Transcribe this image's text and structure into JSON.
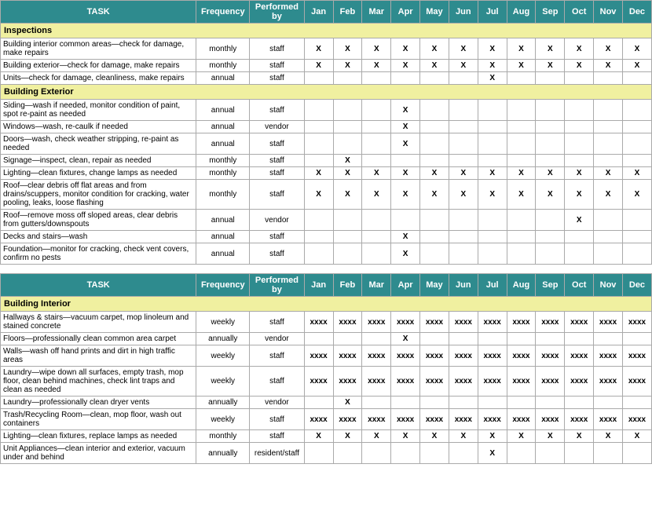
{
  "table1": {
    "header": {
      "task": "TASK",
      "frequency": "Frequency",
      "performed_by": "Performed by",
      "months": [
        "Jan",
        "Feb",
        "Mar",
        "Apr",
        "May",
        "Jun",
        "Jul",
        "Aug",
        "Sep",
        "Oct",
        "Nov",
        "Dec"
      ]
    },
    "sections": [
      {
        "title": "Inspections",
        "rows": [
          {
            "task": "Building interior common areas—check for damage, make repairs",
            "frequency": "monthly",
            "performed_by": "staff",
            "months": [
              "X",
              "X",
              "X",
              "X",
              "X",
              "X",
              "X",
              "X",
              "X",
              "X",
              "X",
              "X"
            ]
          },
          {
            "task": "Building exterior—check for damage, make repairs",
            "frequency": "monthly",
            "performed_by": "staff",
            "months": [
              "X",
              "X",
              "X",
              "X",
              "X",
              "X",
              "X",
              "X",
              "X",
              "X",
              "X",
              "X"
            ]
          },
          {
            "task": "Units—check for damage, cleanliness, make repairs",
            "frequency": "annual",
            "performed_by": "staff",
            "months": [
              "",
              "",
              "",
              "",
              "",
              "",
              "X",
              "",
              "",
              "",
              "",
              ""
            ]
          }
        ]
      },
      {
        "title": "Building Exterior",
        "rows": [
          {
            "task": "Siding—wash if needed, monitor condition of paint, spot re-paint as needed",
            "frequency": "annual",
            "performed_by": "staff",
            "months": [
              "",
              "",
              "",
              "X",
              "",
              "",
              "",
              "",
              "",
              "",
              "",
              ""
            ]
          },
          {
            "task": "Windows—wash, re-caulk if needed",
            "frequency": "annual",
            "performed_by": "vendor",
            "months": [
              "",
              "",
              "",
              "X",
              "",
              "",
              "",
              "",
              "",
              "",
              "",
              ""
            ]
          },
          {
            "task": "Doors—wash, check weather stripping, re-paint as needed",
            "frequency": "annual",
            "performed_by": "staff",
            "months": [
              "",
              "",
              "",
              "X",
              "",
              "",
              "",
              "",
              "",
              "",
              "",
              ""
            ]
          },
          {
            "task": "Signage—inspect, clean, repair as needed",
            "frequency": "monthly",
            "performed_by": "staff",
            "months": [
              "",
              "X",
              "",
              "",
              "",
              "",
              "",
              "",
              "",
              "",
              "",
              ""
            ]
          },
          {
            "task": "Lighting—clean fixtures, change lamps as needed",
            "frequency": "monthly",
            "performed_by": "staff",
            "months": [
              "X",
              "X",
              "X",
              "X",
              "X",
              "X",
              "X",
              "X",
              "X",
              "X",
              "X",
              "X"
            ]
          },
          {
            "task": "Roof—clear debris off flat areas and from drains/scuppers, monitor condition for cracking, water pooling, leaks, loose flashing",
            "frequency": "monthly",
            "performed_by": "staff",
            "months": [
              "X",
              "X",
              "X",
              "X",
              "X",
              "X",
              "X",
              "X",
              "X",
              "X",
              "X",
              "X"
            ]
          },
          {
            "task": "Roof—remove moss off sloped areas, clear debris from gutters/downspouts",
            "frequency": "annual",
            "performed_by": "vendor",
            "months": [
              "",
              "",
              "",
              "",
              "",
              "",
              "",
              "",
              "",
              "X",
              "",
              ""
            ]
          },
          {
            "task": "Decks and stairs—wash",
            "frequency": "annual",
            "performed_by": "staff",
            "months": [
              "",
              "",
              "",
              "X",
              "",
              "",
              "",
              "",
              "",
              "",
              "",
              ""
            ]
          },
          {
            "task": "Foundation—monitor for cracking, check vent covers, confirm no pests",
            "frequency": "annual",
            "performed_by": "staff",
            "months": [
              "",
              "",
              "",
              "X",
              "",
              "",
              "",
              "",
              "",
              "",
              "",
              ""
            ]
          }
        ]
      }
    ]
  },
  "table2": {
    "header": {
      "task": "TASK",
      "frequency": "Frequency",
      "performed_by": "Performed by",
      "months": [
        "Jan",
        "Feb",
        "Mar",
        "Apr",
        "May",
        "Jun",
        "Jul",
        "Aug",
        "Sep",
        "Oct",
        "Nov",
        "Dec"
      ]
    },
    "sections": [
      {
        "title": "Building Interior",
        "rows": [
          {
            "task": "Hallways & stairs—vacuum carpet, mop linoleum and stained concrete",
            "frequency": "weekly",
            "performed_by": "staff",
            "months": [
              "xxxx",
              "xxxx",
              "xxxx",
              "xxxx",
              "xxxx",
              "xxxx",
              "xxxx",
              "xxxx",
              "xxxx",
              "xxxx",
              "xxxx",
              "xxxx"
            ]
          },
          {
            "task": "Floors—professionally clean common area carpet",
            "frequency": "annually",
            "performed_by": "vendor",
            "months": [
              "",
              "",
              "",
              "X",
              "",
              "",
              "",
              "",
              "",
              "",
              "",
              ""
            ]
          },
          {
            "task": "Walls—wash off hand prints and dirt in high traffic areas",
            "frequency": "weekly",
            "performed_by": "staff",
            "months": [
              "xxxx",
              "xxxx",
              "xxxx",
              "xxxx",
              "xxxx",
              "xxxx",
              "xxxx",
              "xxxx",
              "xxxx",
              "xxxx",
              "xxxx",
              "xxxx"
            ]
          },
          {
            "task": "Laundry—wipe down all surfaces, empty trash, mop floor, clean behind machines, check lint traps and clean as needed",
            "frequency": "weekly",
            "performed_by": "staff",
            "months": [
              "xxxx",
              "xxxx",
              "xxxx",
              "xxxx",
              "xxxx",
              "xxxx",
              "xxxx",
              "xxxx",
              "xxxx",
              "xxxx",
              "xxxx",
              "xxxx"
            ]
          },
          {
            "task": "Laundry—professionally clean dryer vents",
            "frequency": "annually",
            "performed_by": "vendor",
            "months": [
              "",
              "X",
              "",
              "",
              "",
              "",
              "",
              "",
              "",
              "",
              "",
              ""
            ]
          },
          {
            "task": "Trash/Recycling Room—clean, mop floor, wash out containers",
            "frequency": "weekly",
            "performed_by": "staff",
            "months": [
              "xxxx",
              "xxxx",
              "xxxx",
              "xxxx",
              "xxxx",
              "xxxx",
              "xxxx",
              "xxxx",
              "xxxx",
              "xxxx",
              "xxxx",
              "xxxx"
            ]
          },
          {
            "task": "Lighting—clean fixtures, replace lamps as needed",
            "frequency": "monthly",
            "performed_by": "staff",
            "months": [
              "X",
              "X",
              "X",
              "X",
              "X",
              "X",
              "X",
              "X",
              "X",
              "X",
              "X",
              "X"
            ]
          },
          {
            "task": "Unit Appliances—clean interior and exterior, vacuum under and behind",
            "frequency": "annually",
            "performed_by": "resident/staff",
            "months": [
              "",
              "",
              "",
              "",
              "",
              "",
              "X",
              "",
              "",
              "",
              "",
              ""
            ]
          }
        ]
      }
    ]
  }
}
